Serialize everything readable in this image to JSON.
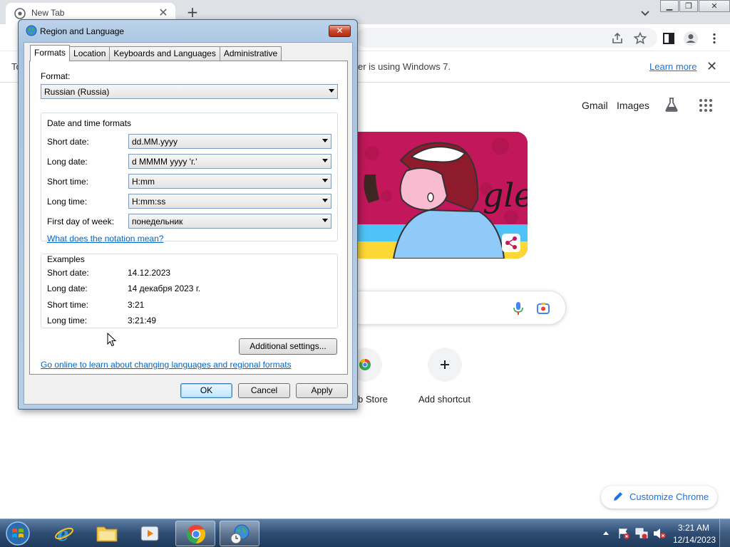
{
  "chrome": {
    "tab_title": "New Tab",
    "infobar_left": "To",
    "infobar_right": "er is using Windows 7.",
    "learn_more": "Learn more",
    "ntp_links": {
      "gmail": "Gmail",
      "images": "Images"
    },
    "shortcuts": {
      "store_label": "b Store",
      "add_label": "Add shortcut"
    },
    "customize_label": "Customize Chrome"
  },
  "dialog": {
    "title": "Region and Language",
    "tabs": [
      "Formats",
      "Location",
      "Keyboards and Languages",
      "Administrative"
    ],
    "format_label": "Format:",
    "format_value": "Russian (Russia)",
    "date_time_group": "Date and time formats",
    "fields": [
      {
        "label": "Short date:",
        "value": "dd.MM.yyyy"
      },
      {
        "label": "Long date:",
        "value": "d MMMM yyyy 'г.'"
      },
      {
        "label": "Short time:",
        "value": "H:mm"
      },
      {
        "label": "Long time:",
        "value": "H:mm:ss"
      },
      {
        "label": "First day of week:",
        "value": "понедельник"
      }
    ],
    "notation_link": "What does the notation mean?",
    "examples_group": "Examples",
    "examples": [
      {
        "label": "Short date:",
        "value": "14.12.2023"
      },
      {
        "label": "Long date:",
        "value": "14 декабря 2023 г."
      },
      {
        "label": "Short time:",
        "value": "3:21"
      },
      {
        "label": "Long time:",
        "value": "3:21:49"
      }
    ],
    "additional_settings": "Additional settings...",
    "online_link": "Go online to learn about changing languages and regional formats",
    "ok": "OK",
    "cancel": "Cancel",
    "apply": "Apply"
  },
  "taskbar": {
    "time": "3:21 AM",
    "date": "12/14/2023"
  },
  "colors": {
    "accent_blue": "#1a73e8",
    "link_blue": "#0066cc",
    "doodle_pink": "#c2185b"
  }
}
